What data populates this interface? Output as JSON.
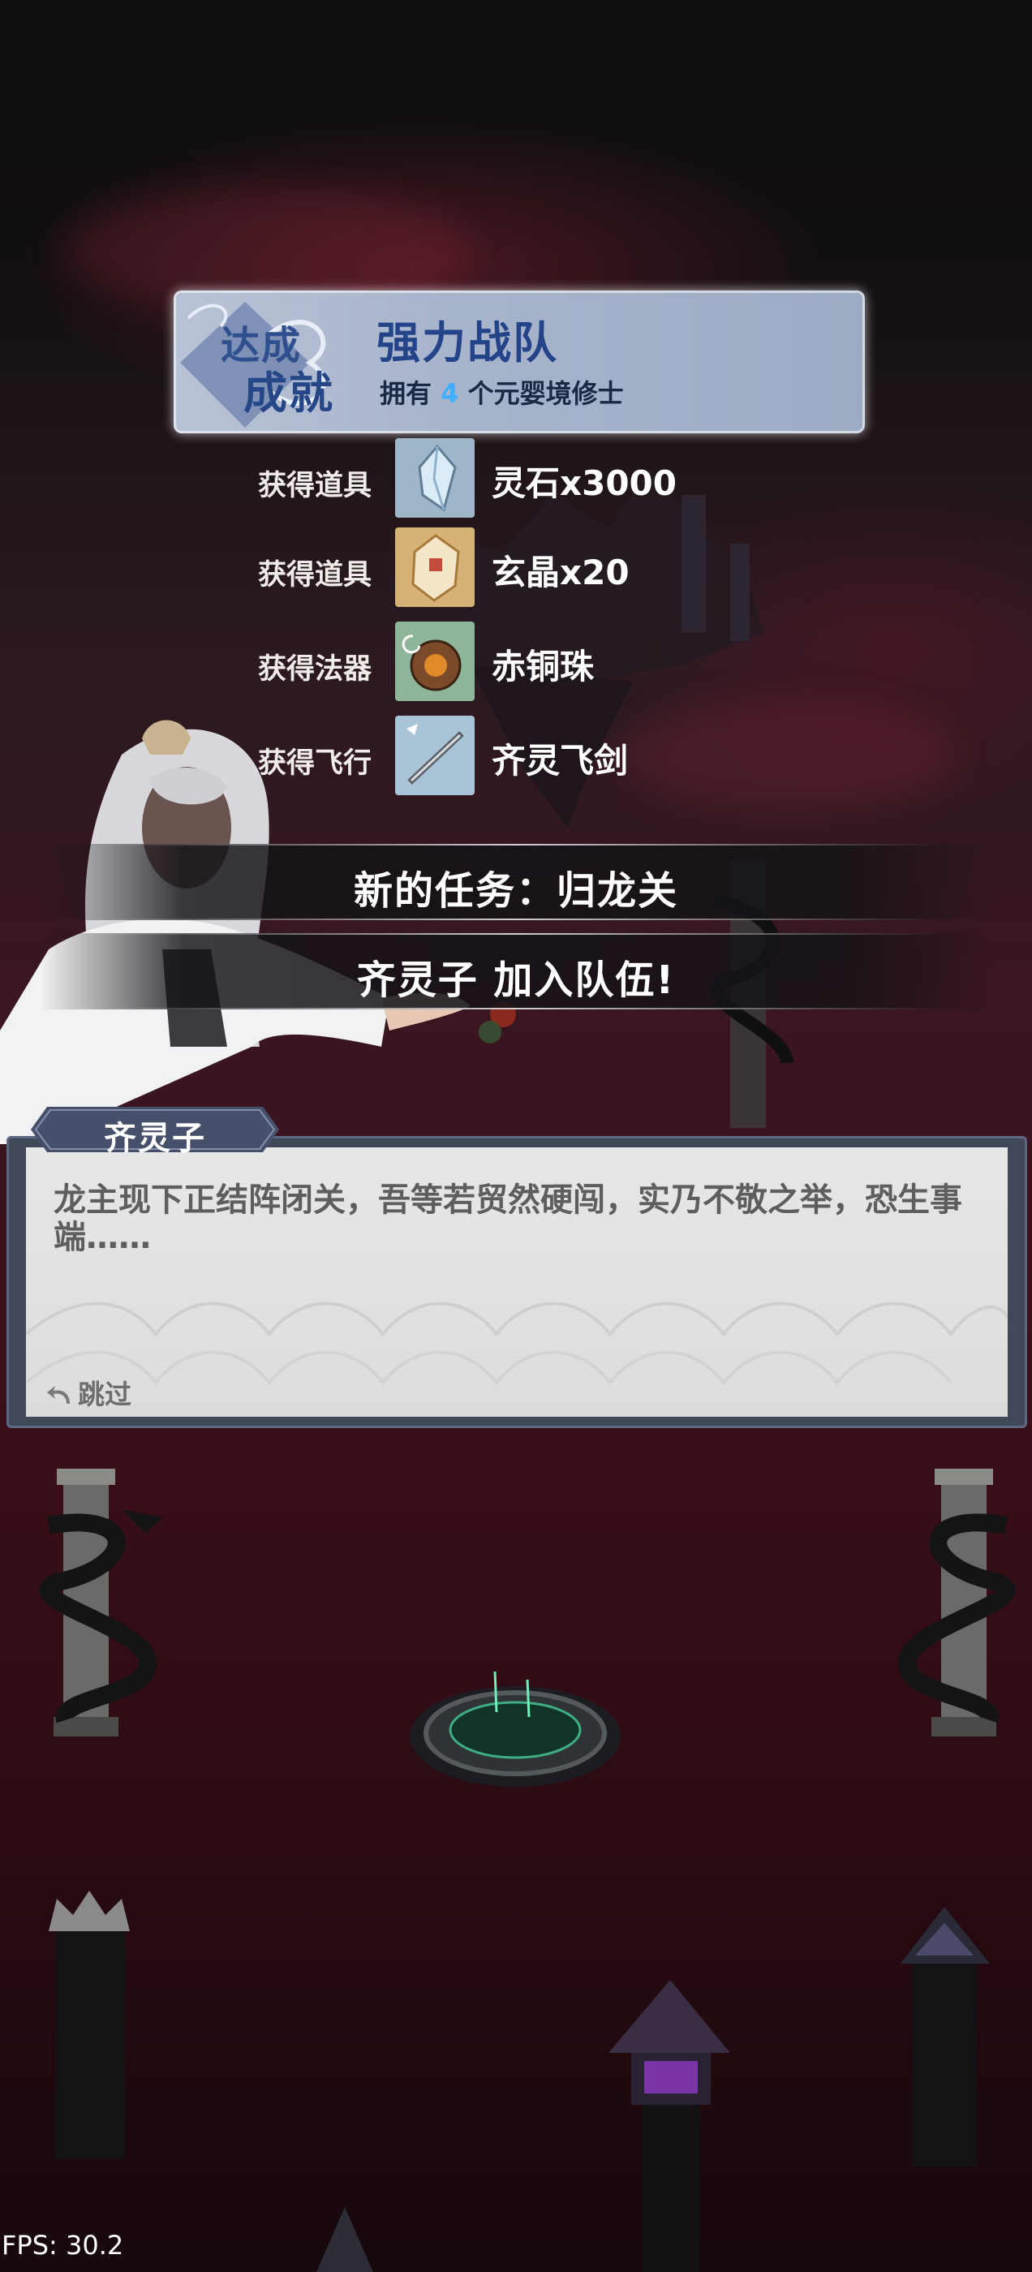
{
  "achievement": {
    "label_line1": "达成",
    "label_line2": "成就",
    "title": "强力战队",
    "desc_prefix": "拥有 ",
    "desc_count": "4",
    "desc_suffix": " 个元婴境修士"
  },
  "rewards": [
    {
      "label": "获得道具",
      "name": "灵石x3000",
      "icon": "spirit-stone-icon"
    },
    {
      "label": "获得道具",
      "name": "玄晶x20",
      "icon": "mystic-crystal-icon"
    },
    {
      "label": "获得法器",
      "name": "赤铜珠",
      "icon": "red-copper-bead-icon"
    },
    {
      "label": "获得飞行",
      "name": "齐灵飞剑",
      "icon": "flying-sword-icon"
    }
  ],
  "notices": [
    {
      "text": "新的任务：归龙关"
    },
    {
      "text": "齐灵子 加入队伍!"
    }
  ],
  "dialogue": {
    "speaker": "齐灵子",
    "text": "龙主现下正结阵闭关，吾等若贸然硬闯，实乃不敬之举，恐生事端……",
    "skip_label": "跳过"
  },
  "fps": "FPS: 30.2",
  "colors": {
    "achievement_title": "#24448a",
    "highlight_number": "#3fb0ff",
    "background_red": "#3b0f19"
  }
}
